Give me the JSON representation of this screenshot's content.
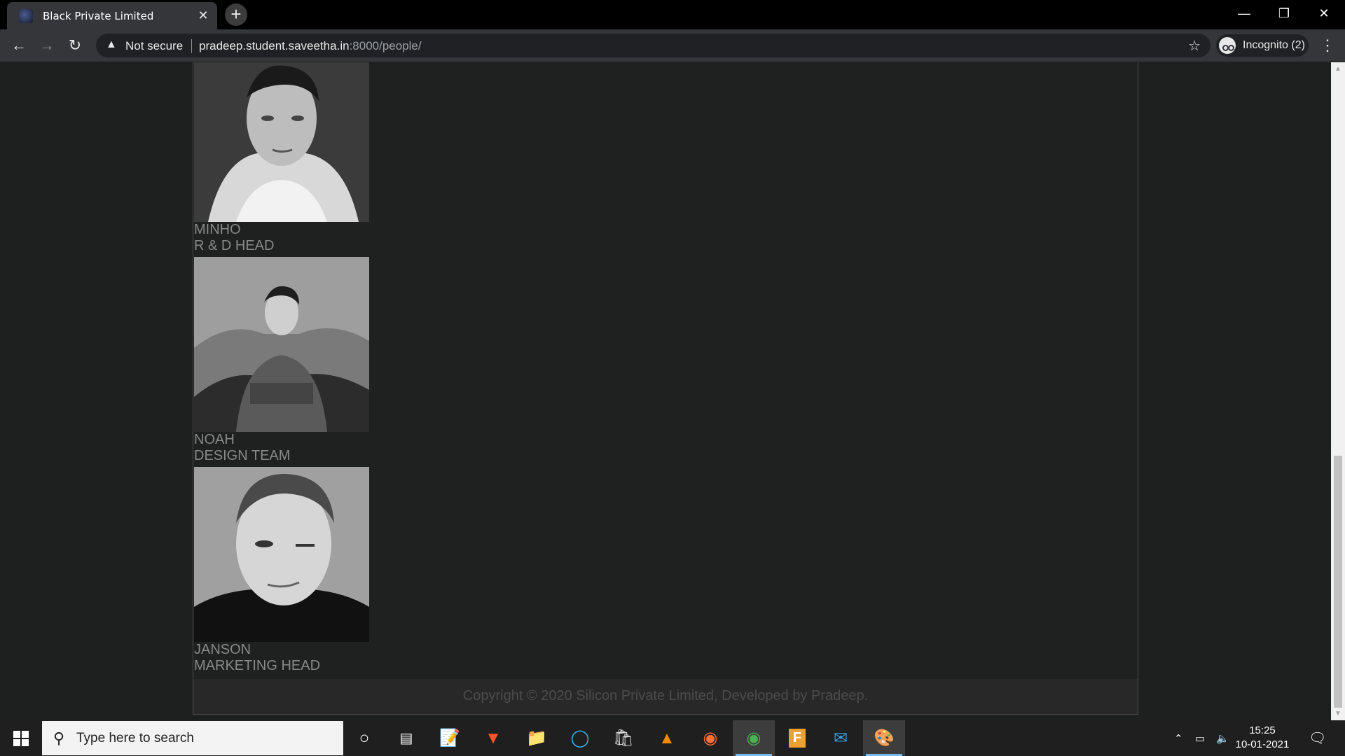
{
  "browser": {
    "tab_title": "Black Private Limited",
    "tab_close": "✕",
    "new_tab": "+",
    "security_label": "Not secure",
    "url_host": "pradeep.student.saveetha.in",
    "url_rest": ":8000/people/",
    "profile_label": "Incognito (2)"
  },
  "people": [
    {
      "name": "MINHO",
      "role": "R & D HEAD"
    },
    {
      "name": "NOAH",
      "role": "DESIGN TEAM"
    },
    {
      "name": "JANSON",
      "role": "MARKETING HEAD"
    }
  ],
  "footer": {
    "text": "Copyright © 2020 Silicon Private Limited, Developed by Pradeep."
  },
  "taskbar": {
    "search_placeholder": "Type here to search",
    "time": "15:25",
    "date": "10-01-2021"
  },
  "colors": {
    "page_bg": "#1e1f1f",
    "text_muted": "#888888",
    "footer_text": "#4c4c4c"
  }
}
